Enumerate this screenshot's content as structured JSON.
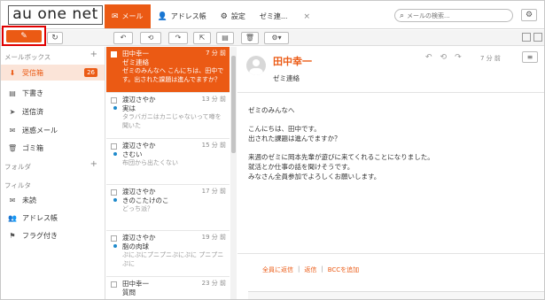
{
  "header": {
    "logo": "au one net",
    "tabs": [
      {
        "icon": "✉",
        "label": "メール"
      },
      {
        "icon": "👤",
        "label": "アドレス帳"
      },
      {
        "icon": "⚙",
        "label": "設定"
      },
      {
        "icon": "",
        "label": "ゼミ連..."
      }
    ],
    "tab_close": "×",
    "search_placeholder": "メールの検索..."
  },
  "toolbar": {
    "compose_icon": "✎",
    "refresh_icon": "↻",
    "reply_icon": "↶",
    "reply_all_icon": "⟲",
    "forward_icon": "↷",
    "move_icon": "⇱",
    "archive_icon": "▤",
    "delete_icon": "🗑",
    "more_icon": "⚙▾"
  },
  "sidebar": {
    "mailbox_header": "メールボックス",
    "folder_header": "フォルダ",
    "filter_header": "フィルタ",
    "items": [
      {
        "icon": "inbox-icon",
        "glyph": "⬇",
        "label": "受信箱",
        "badge": "26"
      },
      {
        "icon": "draft-icon",
        "glyph": "▤",
        "label": "下書き"
      },
      {
        "icon": "sent-icon",
        "glyph": "➤",
        "label": "送信済"
      },
      {
        "icon": "spam-icon",
        "glyph": "✉",
        "label": "迷惑メール"
      },
      {
        "icon": "trash-icon",
        "glyph": "🗑",
        "label": "ゴミ箱"
      }
    ],
    "filters": [
      {
        "icon": "unread-icon",
        "glyph": "✉",
        "label": "未読"
      },
      {
        "icon": "contacts-icon",
        "glyph": "👥",
        "label": "アドレス帳"
      },
      {
        "icon": "flag-icon",
        "glyph": "⚑",
        "label": "フラグ付き"
      }
    ]
  },
  "mails": [
    {
      "from": "田中幸一",
      "time": "7 分 前",
      "subject": "ゼミ連絡",
      "preview": "ゼミのみんなへ こんにちは、田中です。出された課題は進んでますか？"
    },
    {
      "from": "渡辺さやか",
      "time": "13 分 前",
      "subject": "実は",
      "preview": "タラバガニはカニじゃないって噂を聞いた"
    },
    {
      "from": "渡辺さやか",
      "time": "15 分 前",
      "subject": "さむい",
      "preview": "布団から出たくない"
    },
    {
      "from": "渡辺さやか",
      "time": "17 分 前",
      "subject": "きのこたけのこ",
      "preview": "どっち派？"
    },
    {
      "from": "渡辺さやか",
      "time": "19 分 前",
      "subject": "脂の肉球",
      "preview": "ぷにぷにプニプニぷにぷに プニプニぷに"
    },
    {
      "from": "田中幸一",
      "time": "23 分 前",
      "subject": "質問",
      "preview": ""
    }
  ],
  "reader": {
    "from": "田中幸一",
    "subject": "ゼミ連絡",
    "time": "7 分 前",
    "body": [
      "ゼミのみんなへ",
      "",
      "こんにちは、田中です。",
      "出された課題は進んでますか？",
      "",
      "来週のゼミに岡本先輩が遊びに来てくれることになりました。",
      "就活とか仕事の話を聞けそうです。",
      "みなさん全員参加でよろしくお願いします。"
    ],
    "reply_all": "全員に返信",
    "reply": "返信",
    "bcc": "BCCを追加",
    "sep": "|"
  },
  "colors": {
    "accent": "#eb5a14",
    "highlight": "#e00000",
    "unread_dot": "#1e8acb"
  }
}
